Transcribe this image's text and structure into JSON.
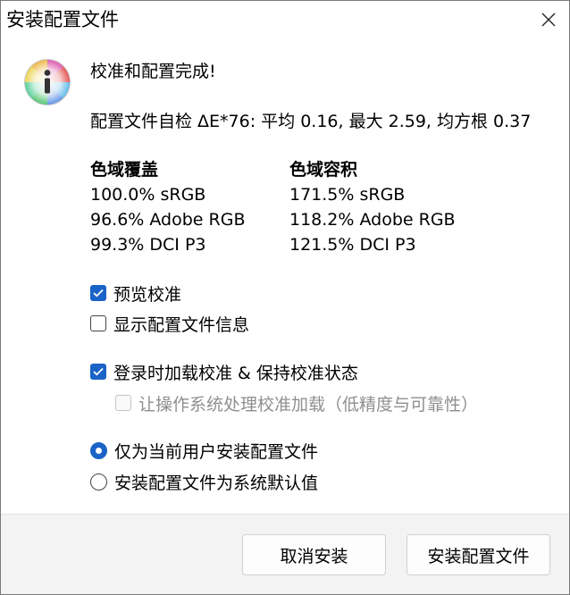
{
  "window": {
    "title": "安装配置文件"
  },
  "message": {
    "headline": "校准和配置完成!",
    "profile_check": "配置文件自检 ΔE*76: 平均 0.16, 最大 2.59, 均方根 0.37"
  },
  "gamut_coverage": {
    "heading": "色域覆盖",
    "items": [
      "100.0% sRGB",
      "96.6% Adobe RGB",
      "99.3% DCI P3"
    ]
  },
  "gamut_volume": {
    "heading": "色域容积",
    "items": [
      "171.5% sRGB",
      "118.2% Adobe RGB",
      "121.5% DCI P3"
    ]
  },
  "options": {
    "preview_calibration": {
      "label": "预览校准",
      "checked": true
    },
    "show_profile_info": {
      "label": "显示配置文件信息",
      "checked": false
    },
    "load_on_login": {
      "label": "登录时加载校准 & 保持校准状态",
      "checked": true
    },
    "os_handles_loading": {
      "label": "让操作系统处理校准加载（低精度与可靠性）",
      "checked": false,
      "disabled": true
    }
  },
  "install_scope": {
    "current_user": {
      "label": "仅为当前用户安装配置文件",
      "selected": true
    },
    "system_default": {
      "label": "安装配置文件为系统默认值",
      "selected": false
    }
  },
  "buttons": {
    "cancel": "取消安装",
    "install": "安装配置文件"
  },
  "colors": {
    "accent": "#1a63c7",
    "footer_bg": "#f3f3f3"
  },
  "icons": {
    "info": "info-icon",
    "close": "close-icon",
    "check": "check-icon"
  }
}
